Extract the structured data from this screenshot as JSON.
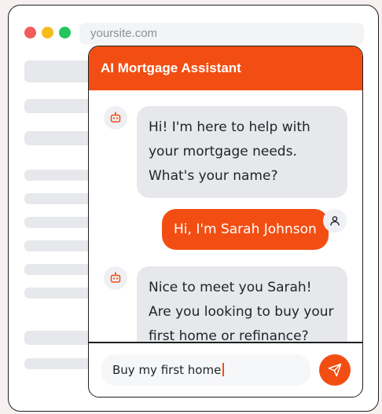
{
  "browser": {
    "url": "yoursite.com"
  },
  "chat": {
    "title": "AI Mortgage Assistant",
    "messages": [
      {
        "sender": "bot",
        "avatar_icon": "robot-icon",
        "text": "Hi! I'm here to help with your mortgage needs. What's your name?"
      },
      {
        "sender": "user",
        "avatar_icon": "user-icon",
        "text": "Hi, I'm Sarah Johnson"
      },
      {
        "sender": "bot",
        "avatar_icon": "robot-icon",
        "text": "Nice to meet you Sarah! Are you looking to buy your first home or refinance?"
      }
    ],
    "input_value": "Buy my first home",
    "send_icon": "send-icon"
  },
  "colors": {
    "accent": "#f24e13",
    "bot_bubble": "#e6e8ec",
    "window_dot_red": "#f05d5d",
    "window_dot_yellow": "#f6bb1c",
    "window_dot_green": "#22c55e"
  }
}
